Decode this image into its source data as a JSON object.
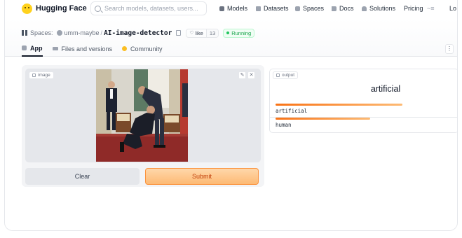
{
  "navbar": {
    "brand": "Hugging Face",
    "search_placeholder": "Search models, datasets, users...",
    "links": {
      "models": "Models",
      "datasets": "Datasets",
      "spaces": "Spaces",
      "docs": "Docs",
      "solutions": "Solutions",
      "pricing": "Pricing"
    },
    "more": "~≡",
    "login": "Lo"
  },
  "space": {
    "label": "Spaces:",
    "owner": "umm-maybe",
    "separator": "/",
    "name": "AI-image-detector",
    "like_label": "like",
    "like_count": "13",
    "status": "Running"
  },
  "tabs": {
    "app": "App",
    "files": "Files and versions",
    "community": "Community"
  },
  "menu_kebab": "⋮",
  "input": {
    "label": "image",
    "clear_label": "Clear",
    "submit_label": "Submit",
    "edit_glyph": "✎",
    "close_glyph": "✕"
  },
  "output": {
    "label": "output",
    "top_label": "artificial",
    "confidences": [
      {
        "label": "artificial",
        "value": 0.71
      },
      {
        "label": "human",
        "value": 0.53
      }
    ]
  },
  "colors": {
    "accent_orange": "#f97316",
    "running_green": "#16a34a",
    "logo_yellow": "#ffd21e"
  }
}
